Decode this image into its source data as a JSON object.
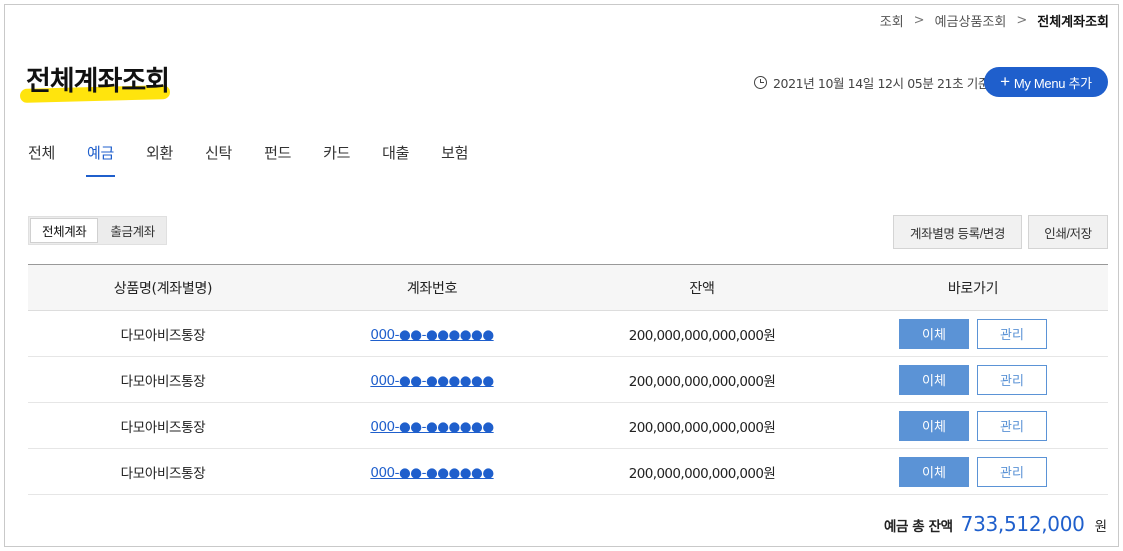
{
  "breadcrumb": {
    "items": [
      "조회",
      "예금상품조회",
      "전체계좌조회"
    ],
    "separator": ">"
  },
  "page": {
    "title": "전체계좌조회",
    "timestamp": "2021년 10월 14일 12시 05분 21초 기준"
  },
  "my_menu_button": {
    "plus": "+",
    "label": "My Menu 추가"
  },
  "tabs": [
    {
      "label": "전체",
      "active": false
    },
    {
      "label": "예금",
      "active": true
    },
    {
      "label": "외환",
      "active": false
    },
    {
      "label": "신탁",
      "active": false
    },
    {
      "label": "펀드",
      "active": false
    },
    {
      "label": "카드",
      "active": false
    },
    {
      "label": "대출",
      "active": false
    },
    {
      "label": "보험",
      "active": false
    }
  ],
  "segment": {
    "all_label": "전체계좌",
    "withdraw_label": "출금계좌"
  },
  "actions": {
    "rename_label": "계좌별명 등록/변경",
    "print_label": "인쇄/저장"
  },
  "table": {
    "headers": [
      "상품명(계좌별명)",
      "계좌번호",
      "잔액",
      "바로가기"
    ],
    "rows": [
      {
        "name": "다모아비즈통장",
        "account": "000-●●-●●●●●●",
        "balance": "200,000,000,000,000원",
        "transfer": "이체",
        "manage": "관리"
      },
      {
        "name": "다모아비즈통장",
        "account": "000-●●-●●●●●●",
        "balance": "200,000,000,000,000원",
        "transfer": "이체",
        "manage": "관리"
      },
      {
        "name": "다모아비즈통장",
        "account": "000-●●-●●●●●●",
        "balance": "200,000,000,000,000원",
        "transfer": "이체",
        "manage": "관리"
      },
      {
        "name": "다모아비즈통장",
        "account": "000-●●-●●●●●●",
        "balance": "200,000,000,000,000원",
        "transfer": "이체",
        "manage": "관리"
      }
    ]
  },
  "total": {
    "label": "예금 총 잔액",
    "value": "733,512,000",
    "unit": "원"
  },
  "colors": {
    "accent": "#1f5fcc",
    "button": "#5b93d6",
    "highlight": "#ffe300"
  },
  "icons": {
    "clock": "clock-icon",
    "plus": "plus-icon"
  }
}
